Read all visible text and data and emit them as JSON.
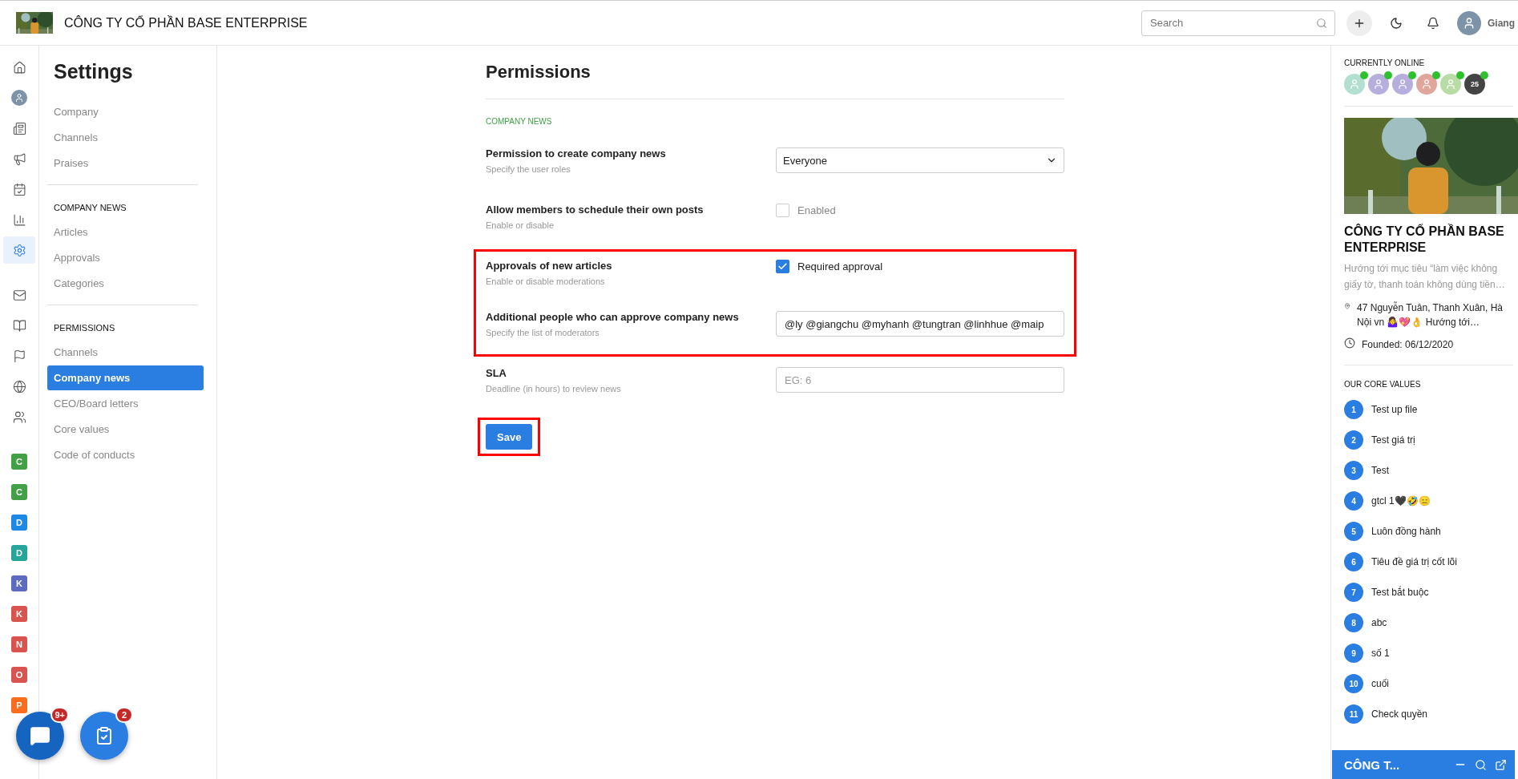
{
  "header": {
    "company": "CÔNG TY CỔ PHẦN BASE ENTERPRISE",
    "search_placeholder": "Search",
    "user_name": "Giang"
  },
  "rail": {
    "items": [
      {
        "kind": "home",
        "selected": false
      },
      {
        "kind": "avatar",
        "selected": false
      },
      {
        "kind": "newspaper",
        "selected": false
      },
      {
        "kind": "megaphone",
        "selected": false
      },
      {
        "kind": "calendar",
        "selected": false
      },
      {
        "kind": "chart",
        "selected": false
      },
      {
        "kind": "settings",
        "selected": true
      },
      {
        "kind": "mail",
        "selected": false
      },
      {
        "kind": "book",
        "selected": false
      },
      {
        "kind": "flag",
        "selected": false
      },
      {
        "kind": "globe",
        "selected": false
      },
      {
        "kind": "people",
        "selected": false
      }
    ],
    "workspaces": [
      {
        "letter": "C",
        "color": "#43a047"
      },
      {
        "letter": "C",
        "color": "#43a047"
      },
      {
        "letter": "D",
        "color": "#1e88e5"
      },
      {
        "letter": "D",
        "color": "#26a69a"
      },
      {
        "letter": "K",
        "color": "#5c6bc0"
      },
      {
        "letter": "K",
        "color": "#d9534f"
      },
      {
        "letter": "N",
        "color": "#d9534f"
      },
      {
        "letter": "O",
        "color": "#d9534f"
      },
      {
        "letter": "P",
        "color": "#fb6d1c"
      }
    ]
  },
  "settings": {
    "title": "Settings",
    "groups": [
      {
        "items": [
          {
            "label": "Company",
            "selected": false
          },
          {
            "label": "Channels",
            "selected": false
          },
          {
            "label": "Praises",
            "selected": false
          }
        ]
      },
      {
        "heading": "COMPANY NEWS",
        "items": [
          {
            "label": "Articles",
            "selected": false
          },
          {
            "label": "Approvals",
            "selected": false
          },
          {
            "label": "Categories",
            "selected": false
          }
        ]
      },
      {
        "heading": "PERMISSIONS",
        "items": [
          {
            "label": "Channels",
            "selected": false
          },
          {
            "label": "Company news",
            "selected": true
          },
          {
            "label": "CEO/Board letters",
            "selected": false
          },
          {
            "label": "Core values",
            "selected": false
          },
          {
            "label": "Code of conducts",
            "selected": false
          }
        ]
      }
    ]
  },
  "page": {
    "title": "Permissions",
    "section": "COMPANY NEWS",
    "rows": [
      {
        "kind": "select",
        "label": "Permission to create company news",
        "hint": "Specify the user roles",
        "value": "Everyone",
        "highlighted": false
      },
      {
        "kind": "checkbox",
        "label": "Allow members to schedule their own posts",
        "hint": "Enable or disable",
        "option": "Enabled",
        "checked": false,
        "highlighted": false
      },
      {
        "kind": "checkbox",
        "label": "Approvals of new articles",
        "hint": "Enable or disable moderations",
        "option": "Required approval",
        "checked": true,
        "highlighted": true
      },
      {
        "kind": "text",
        "label": "Additional people who can approve company news",
        "hint": "Specify the list of moderators",
        "value": "@ly @giangchu @myhanh @tungtran @linhhue @maip",
        "highlighted": true
      },
      {
        "kind": "text",
        "label": "SLA",
        "hint": "Deadline (in hours) to review news",
        "placeholder": "EG: 6",
        "highlighted": false
      }
    ],
    "save": {
      "label": "Save",
      "highlighted": true
    }
  },
  "online": {
    "title": "CURRENTLY ONLINE",
    "avatars": [
      {
        "color": "#b2dfd0"
      },
      {
        "color": "#b6aedc"
      },
      {
        "color": "#b6aedc"
      },
      {
        "color": "#e0a69c"
      },
      {
        "color": "#b9dba6"
      }
    ],
    "more": "25"
  },
  "company": {
    "name": "CÔNG TY CỔ PHẦN BASE ENTERPRISE",
    "description": "Hướng tới mục tiêu “làm việc không giấy tờ, thanh toán không dùng tiền…",
    "address": "47 Nguyễn Tuân, Thanh Xuân, Hà Nội vn 🤷‍♀️💖👌 Hướng tới…",
    "founded": "Founded: 06/12/2020"
  },
  "core_values": {
    "title": "OUR CORE VALUES",
    "items": [
      {
        "number": "1",
        "label": "Test up file"
      },
      {
        "number": "2",
        "label": "Test giá trị"
      },
      {
        "number": "3",
        "label": "Test"
      },
      {
        "number": "4",
        "label": "gtcl 1🖤🤣😑"
      },
      {
        "number": "5",
        "label": "Luôn đồng hành"
      },
      {
        "number": "6",
        "label": "Tiêu đề giá trị cốt lõi"
      },
      {
        "number": "7",
        "label": "Test bắt buộc"
      },
      {
        "number": "8",
        "label": "abc"
      },
      {
        "number": "9",
        "label": "số 1"
      },
      {
        "number": "10",
        "label": "cuối"
      },
      {
        "number": "11",
        "label": "Check quyền"
      }
    ]
  },
  "fabs": {
    "chat_badge": "9+",
    "tasks_badge": "2"
  },
  "chat_bar": {
    "title": "CÔNG T..."
  }
}
